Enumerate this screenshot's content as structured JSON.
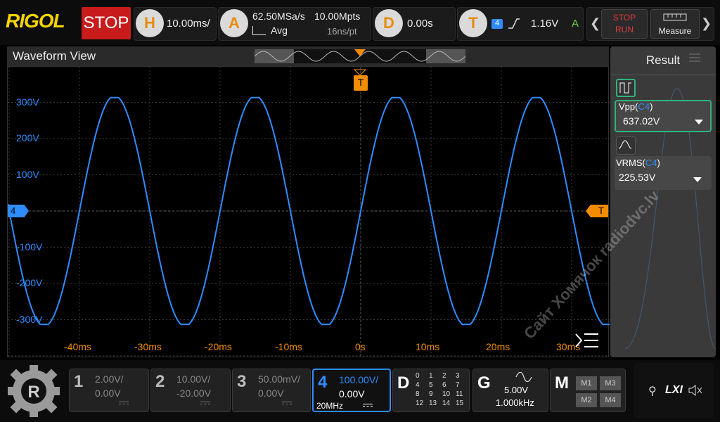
{
  "brand": "RIGOL",
  "run_state": "STOP",
  "horizontal": {
    "badge": "H",
    "timebase": "10.00ms/"
  },
  "acquire": {
    "badge": "A",
    "sample_rate": "62.50MSa/s",
    "mode": "Avg",
    "memory_depth": "10.00Mpts",
    "sample_interval": "16ns/pt"
  },
  "delay": {
    "badge": "D",
    "value": "0.00s"
  },
  "trigger": {
    "badge": "T",
    "source": "4",
    "level": "1.16V",
    "mode": "A"
  },
  "stop_run": {
    "stop": "STOP",
    "run": "RUN"
  },
  "measure_label": "Measure",
  "waveform_view": {
    "title": "Waveform View",
    "trigger_marker": "T",
    "channel_marker": "4",
    "level_marker": "T"
  },
  "y_labels": [
    "300V",
    "200V",
    "100V",
    "-100V",
    "-200V",
    "-300V"
  ],
  "x_labels": [
    "-40ms",
    "-30ms",
    "-20ms",
    "-10ms",
    "0s",
    "10ms",
    "20ms",
    "30ms"
  ],
  "result": {
    "title": "Result",
    "items": [
      {
        "name": "Vpp(",
        "src": "C4",
        "close": ")",
        "value": "637.02V"
      },
      {
        "name": "VRMS(",
        "src": "C4",
        "close": ")",
        "value": "225.53V"
      }
    ]
  },
  "channels": [
    {
      "num": "1",
      "scale": "2.00V/",
      "offset": "0.00V"
    },
    {
      "num": "2",
      "scale": "10.00V/",
      "offset": "-20.00V"
    },
    {
      "num": "3",
      "scale": "50.00mV/",
      "offset": "0.00V"
    },
    {
      "num": "4",
      "scale": "100.00V/",
      "offset": "0.00V",
      "bw": "20MHz"
    }
  ],
  "digital": {
    "label": "D",
    "rows": [
      [
        "0",
        "1",
        "2",
        "3"
      ],
      [
        "4",
        "5",
        "6",
        "7"
      ],
      [
        "8",
        "9",
        "10",
        "11"
      ],
      [
        "12",
        "13",
        "14",
        "15"
      ]
    ]
  },
  "generator": {
    "label": "G",
    "amplitude": "5.00V",
    "frequency": "1.000kHz"
  },
  "math": {
    "label": "M",
    "items": [
      "M1",
      "M3",
      "M2",
      "M4"
    ]
  },
  "status": {
    "lxi": "LXI"
  },
  "watermark": "Сайт Хомячок radiodvc.lv",
  "colors": {
    "ch4": "#2f8cff",
    "trigger": "#f28c00",
    "stop": "#c81b1b",
    "logo": "#f3d400"
  },
  "chart_data": {
    "type": "line",
    "title": "",
    "xlabel": "",
    "ylabel": "",
    "x_unit": "ms",
    "y_unit": "V",
    "xlim": [
      -50,
      35
    ],
    "ylim": [
      -400,
      400
    ],
    "series": [
      {
        "name": "",
        "frequency_hz": 50,
        "amplitude_v": 318,
        "phase_note": "rising zero crossing at 0ms",
        "x": [
          -50,
          -45,
          -40,
          -35,
          -30,
          -25,
          -20,
          -15,
          -10,
          -5,
          0,
          5,
          10,
          15,
          20,
          25,
          30,
          35
        ],
        "y": [
          0,
          -318,
          0,
          318,
          0,
          -318,
          0,
          318,
          0,
          -318,
          0,
          318,
          0,
          -318,
          0,
          318,
          0,
          -318
        ]
      }
    ]
  }
}
